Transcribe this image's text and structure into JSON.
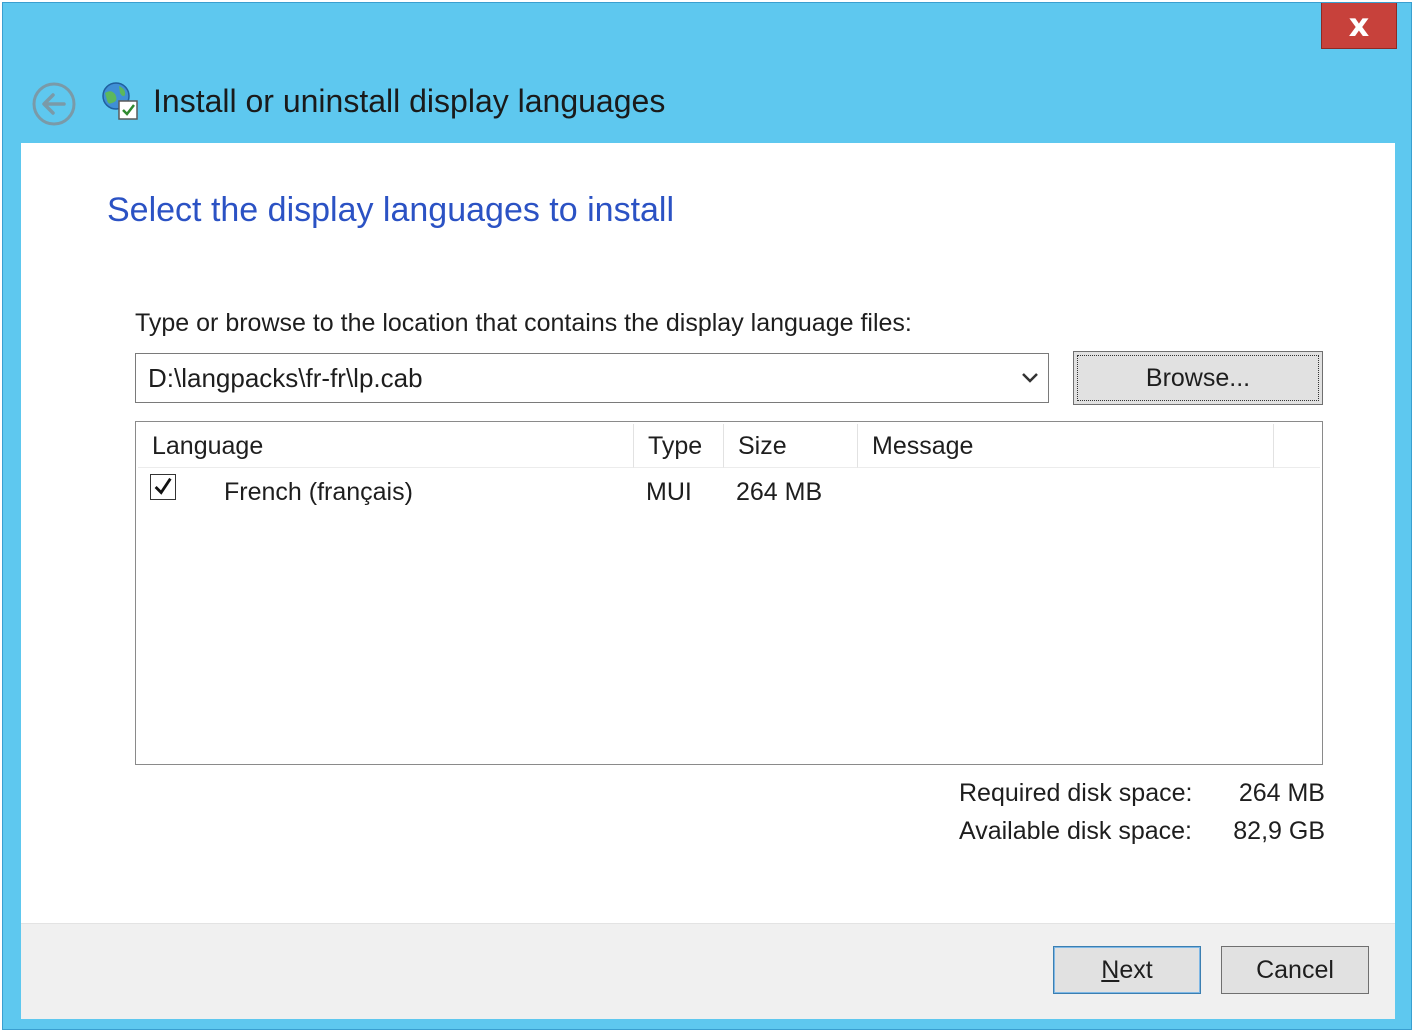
{
  "window": {
    "title": "Install or uninstall display languages",
    "close_glyph": "x",
    "colors": {
      "frame": "#5ec8ef",
      "heading": "#2b52c4",
      "close": "#c7413b"
    }
  },
  "icons": {
    "back": "back-arrow-icon",
    "title": "globe-language-icon",
    "dropdown": "chevron-down-icon",
    "checkbox": "checkmark-icon"
  },
  "main": {
    "heading": "Select the display languages to install",
    "location_label": "Type or browse to the location that contains the display language files:",
    "path_value": "D:\\langpacks\\fr-fr\\lp.cab",
    "browse_label": "Browse..."
  },
  "table": {
    "columns": [
      "Language",
      "Type",
      "Size",
      "Message"
    ],
    "rows": [
      {
        "checked": true,
        "language": "French (français)",
        "type": "MUI",
        "size": "264 MB",
        "message": ""
      }
    ]
  },
  "disk": {
    "required_label": "Required disk space:",
    "required_value": "264 MB",
    "available_label": "Available disk space:",
    "available_value": "82,9 GB"
  },
  "footer": {
    "next_mnemonic": "N",
    "next_rest": "ext",
    "cancel_label": "Cancel"
  }
}
